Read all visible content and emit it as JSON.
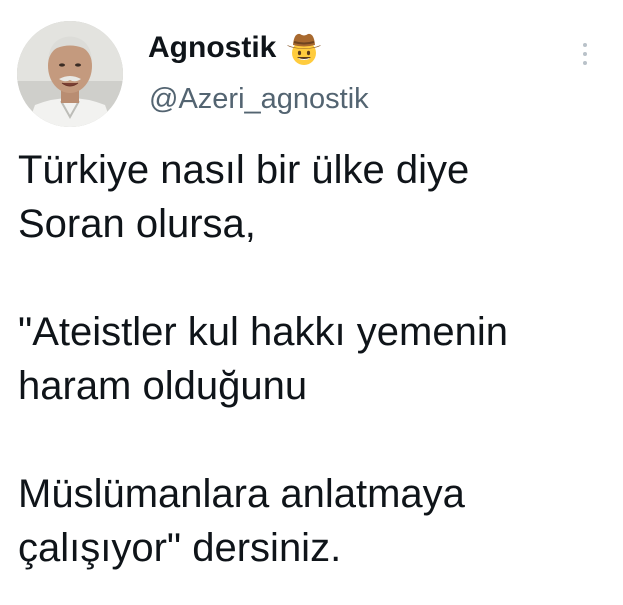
{
  "tweet": {
    "author": {
      "display_name": "Agnostik",
      "handle": "@Azeri_agnostik",
      "badge_emoji": "cowboy-hat-face-emoji",
      "avatar": "profile-photo-elderly-man"
    },
    "more_button": "more-options-icon",
    "paragraphs": [
      "Türkiye nasıl bir ülke diye\nSoran olursa,",
      "\"Ateistler kul hakkı yemenin\nharam olduğunu",
      "Müslümanlara anlatmaya\nçalışıyor\" dersiniz."
    ]
  },
  "colors": {
    "background": "#ffffff",
    "primary_text": "#0f1419",
    "secondary_text": "#536471"
  }
}
